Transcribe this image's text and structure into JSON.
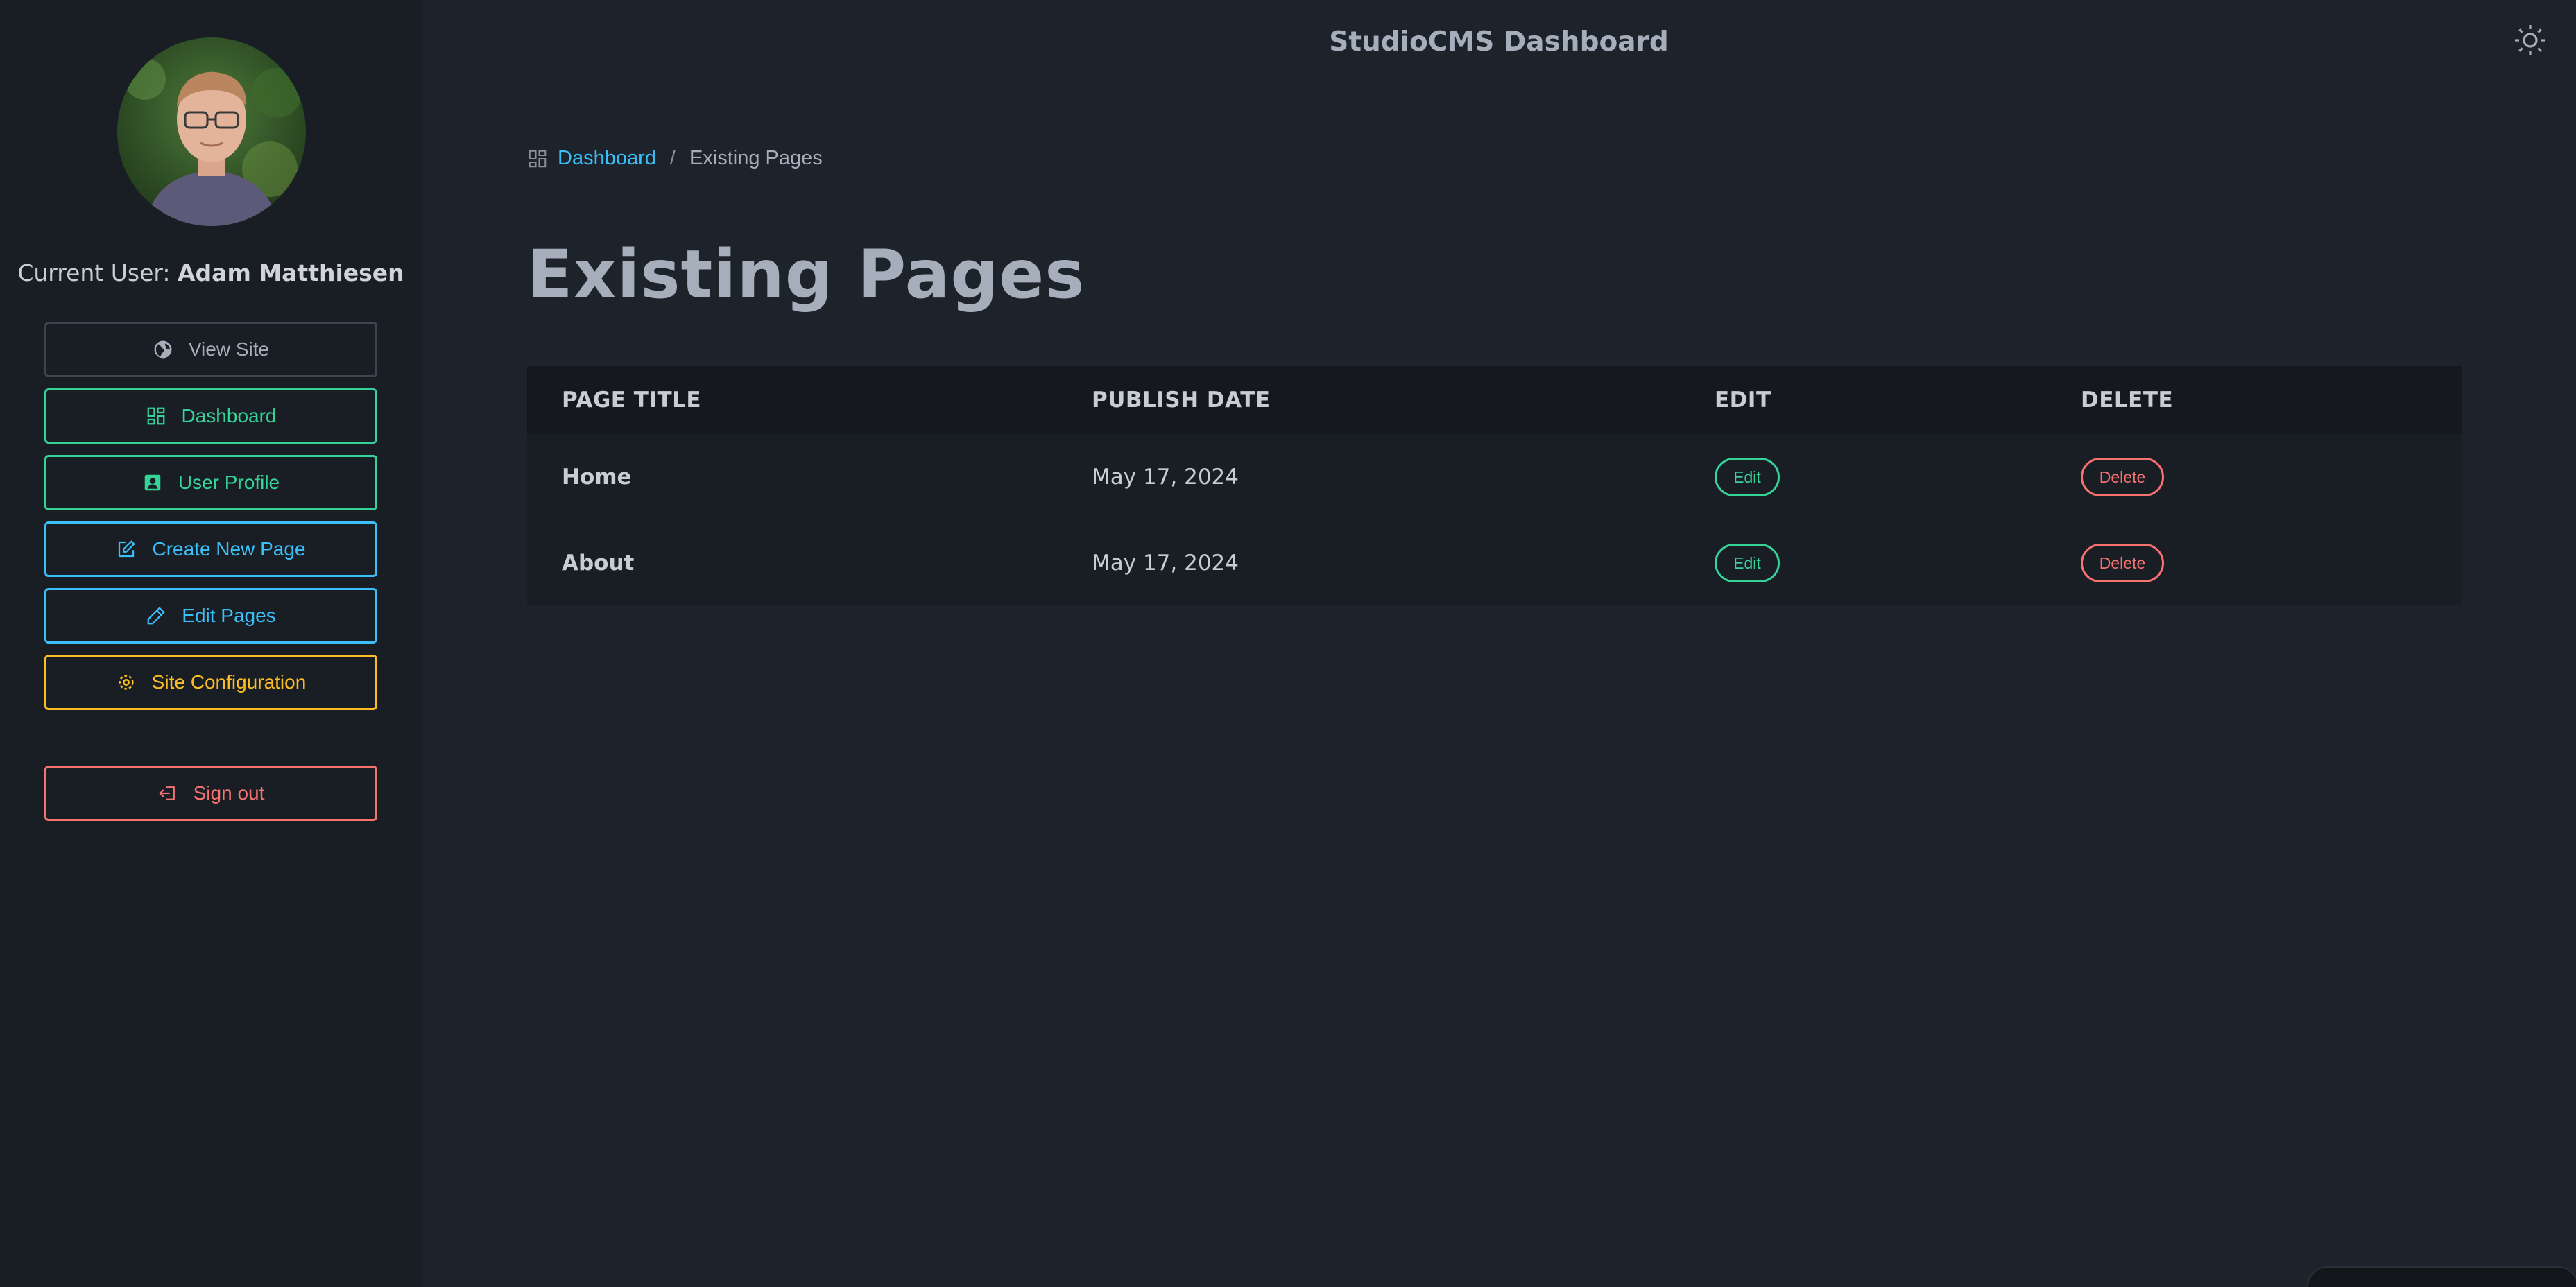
{
  "app": {
    "title": "StudioCMS Dashboard"
  },
  "sidebar": {
    "current_user_prefix": "Current User:",
    "current_user_name": "Adam Matthiesen",
    "buttons": [
      {
        "label": "View Site",
        "icon": "globe-icon",
        "color": "#a6adbb"
      },
      {
        "label": "Dashboard",
        "icon": "dashboard-grid-icon",
        "color": "#36d399"
      },
      {
        "label": "User Profile",
        "icon": "user-profile-icon",
        "color": "#36d399"
      },
      {
        "label": "Create New Page",
        "icon": "edit-square-icon",
        "color": "#3abff8"
      },
      {
        "label": "Edit Pages",
        "icon": "pencil-icon",
        "color": "#3abff8"
      },
      {
        "label": "Site Configuration",
        "icon": "gear-icon",
        "color": "#fbbd23"
      },
      {
        "label": "Sign out",
        "icon": "sign-out-icon",
        "color": "#f87272"
      }
    ]
  },
  "breadcrumb": {
    "link": "Dashboard",
    "separator": "/",
    "current": "Existing Pages"
  },
  "main": {
    "heading": "Existing Pages",
    "table": {
      "columns": [
        "PAGE TITLE",
        "PUBLISH DATE",
        "EDIT",
        "DELETE"
      ],
      "rows": [
        {
          "title": "Home",
          "date": "May 17, 2024",
          "edit": "Edit",
          "delete": "Delete"
        },
        {
          "title": "About",
          "date": "May 17, 2024",
          "edit": "Edit",
          "delete": "Delete"
        }
      ]
    }
  },
  "colors": {
    "background": "#1d232a",
    "sidebar": "#191e24",
    "success": "#36d399",
    "info": "#3abff8",
    "warning": "#fbbd23",
    "error": "#f87272"
  }
}
